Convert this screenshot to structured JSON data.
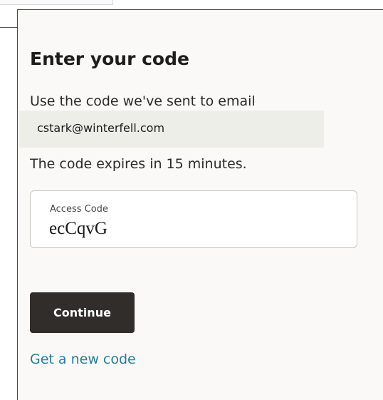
{
  "heading": "Enter your code",
  "instructions": {
    "line1": "Use the code we've sent to email",
    "email": "cstark@winterfell.com",
    "expiry": "The code expires in 15 minutes."
  },
  "access_code": {
    "label": "Access Code",
    "value": "ecCqvG"
  },
  "continue_label": "Continue",
  "new_code_link": "Get a new code",
  "colors": {
    "button": "#312d2a",
    "link": "#227e9e",
    "email_highlight": "#eeeee8"
  }
}
